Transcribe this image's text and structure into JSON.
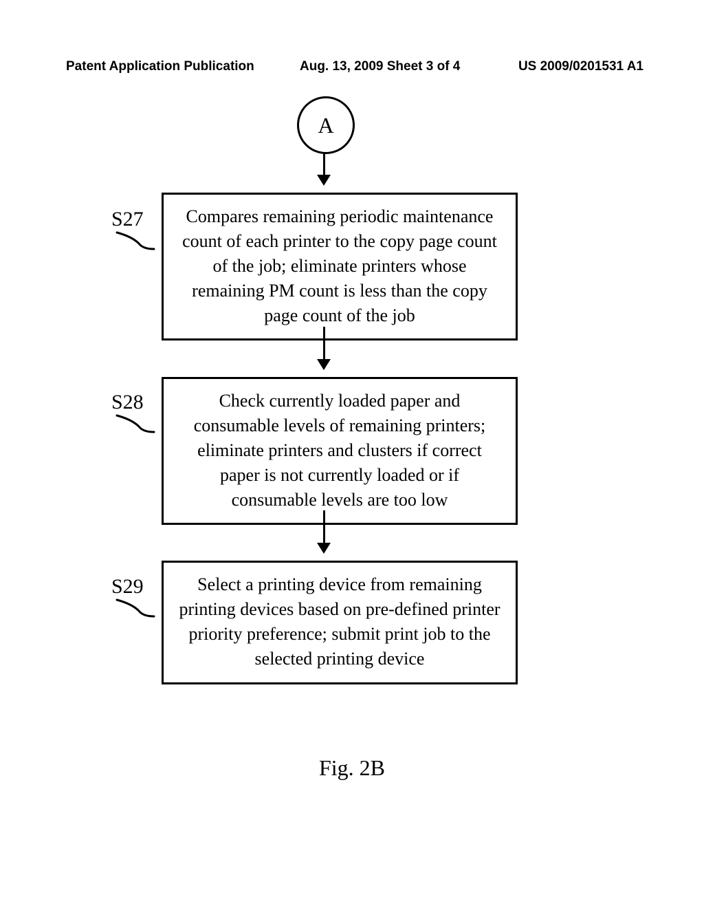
{
  "header": {
    "left": "Patent Application Publication",
    "center": "Aug. 13, 2009  Sheet 3 of 4",
    "right": "US 2009/0201531 A1"
  },
  "flow": {
    "connector_label": "A",
    "steps": [
      {
        "id": "S27",
        "text": "Compares remaining periodic maintenance count of each printer to the copy page count of the job; eliminate printers whose remaining PM count is less than the copy page count of the job"
      },
      {
        "id": "S28",
        "text": "Check currently loaded paper and consumable levels of remaining printers; eliminate printers and clusters if correct paper is not currently loaded or if consumable levels are too low"
      },
      {
        "id": "S29",
        "text": "Select a printing device from remaining printing devices based on pre-defined printer priority preference; submit print job to the selected printing device"
      }
    ]
  },
  "caption": "Fig. 2B"
}
